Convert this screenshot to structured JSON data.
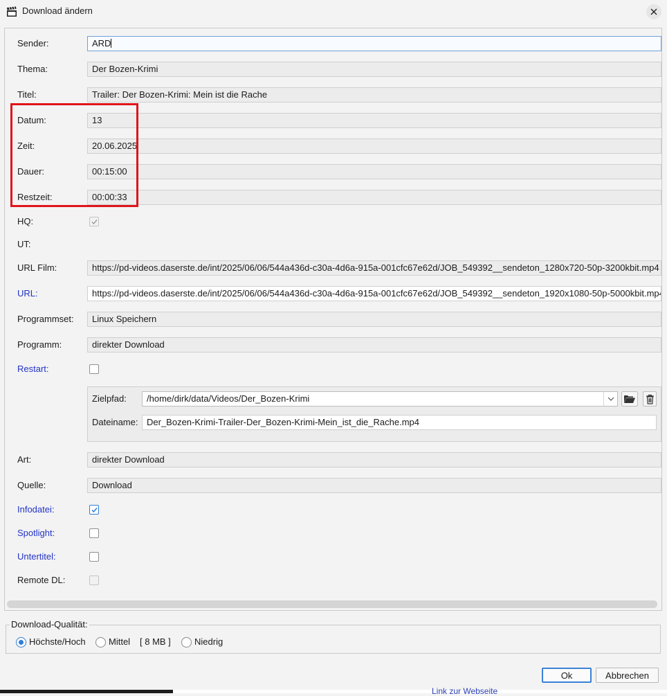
{
  "window": {
    "title": "Download ändern"
  },
  "form": {
    "sender": {
      "label": "Sender:",
      "value": "ARD"
    },
    "thema": {
      "label": "Thema:",
      "value": "Der Bozen-Krimi"
    },
    "titel": {
      "label": "Titel:",
      "value": "Trailer: Der Bozen-Krimi: Mein ist die Rache"
    },
    "datum": {
      "label": "Datum:",
      "value": "13"
    },
    "zeit": {
      "label": "Zeit:",
      "value": "20.06.2025"
    },
    "dauer": {
      "label": "Dauer:",
      "value": "00:15:00"
    },
    "restzeit": {
      "label": "Restzeit:",
      "value": "00:00:33"
    },
    "hq": {
      "label": "HQ:",
      "checked": true
    },
    "ut": {
      "label": "UT:"
    },
    "url_film": {
      "label": "URL Film:",
      "value": "https://pd-videos.daserste.de/int/2025/06/06/544a436d-c30a-4d6a-915a-001cfc67e62d/JOB_549392__sendeton_1280x720-50p-3200kbit.mp4"
    },
    "url": {
      "label": "URL:",
      "value": "https://pd-videos.daserste.de/int/2025/06/06/544a436d-c30a-4d6a-915a-001cfc67e62d/JOB_549392__sendeton_1920x1080-50p-5000kbit.mp4"
    },
    "programmset": {
      "label": "Programmset:",
      "value": "Linux Speichern"
    },
    "programm": {
      "label": "Programm:",
      "value": "direkter Download"
    },
    "restart": {
      "label": "Restart:",
      "checked": false
    },
    "zielpfad": {
      "label": "Zielpfad:",
      "value": "/home/dirk/data/Videos/Der_Bozen-Krimi"
    },
    "dateiname": {
      "label": "Dateiname:",
      "value": "Der_Bozen-Krimi-Trailer-Der_Bozen-Krimi-Mein_ist_die_Rache.mp4"
    },
    "art": {
      "label": "Art:",
      "value": "direkter Download"
    },
    "quelle": {
      "label": "Quelle:",
      "value": "Download"
    },
    "infodatei": {
      "label": "Infodatei:",
      "checked": true
    },
    "spotlight": {
      "label": "Spotlight:",
      "checked": false
    },
    "untertitel": {
      "label": "Untertitel:",
      "checked": false
    },
    "remote_dl": {
      "label": "Remote DL:",
      "checked": false
    }
  },
  "quality": {
    "title": "Download-Qualität:",
    "options": [
      {
        "label": "Höchste/Hoch",
        "selected": true
      },
      {
        "label": "Mittel",
        "selected": false
      },
      {
        "label": "Niedrig",
        "selected": false
      }
    ],
    "size": "[ 8 MB ]"
  },
  "buttons": {
    "ok": "Ok",
    "cancel": "Abbrechen"
  },
  "background": {
    "link": "Link zur Webseite"
  },
  "colors": {
    "accent": "#2f7fd8",
    "blue_label": "#2233c6",
    "highlight": "#e0141a"
  }
}
